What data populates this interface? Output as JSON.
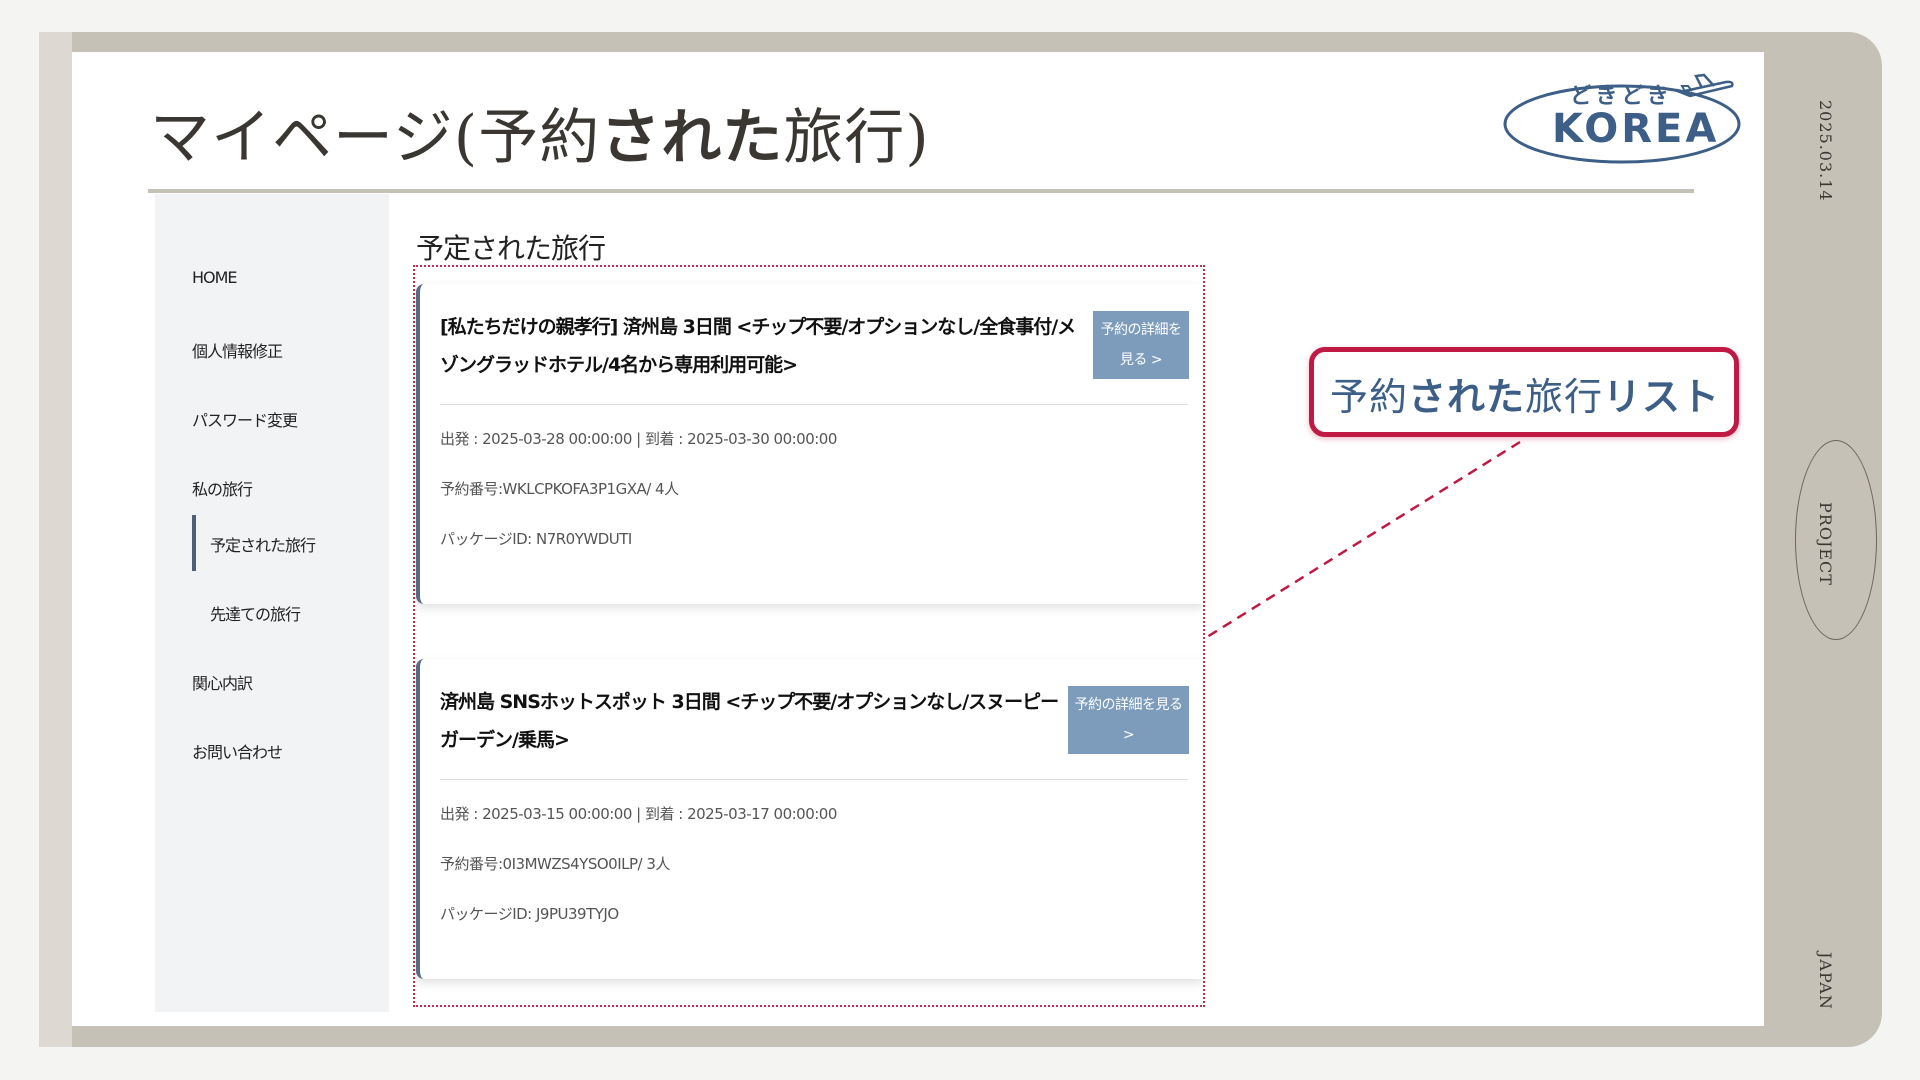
{
  "slide": {
    "title_part1": "マイページ(予約",
    "title_part2": "された",
    "title_part3": "旅行)",
    "date": "2025.03.14",
    "side_label_project": "PROJECT",
    "side_label_japan": "JAPAN"
  },
  "logo": {
    "top_text": "どきどき",
    "main_text": "KOREA",
    "icon": "airplane-icon"
  },
  "sidebar": {
    "items": [
      {
        "label": "HOME"
      },
      {
        "label": "個人情報修正"
      },
      {
        "label": "パスワード変更"
      },
      {
        "label": "私の旅行"
      },
      {
        "label": "予定された旅行"
      },
      {
        "label": "先達ての旅行"
      },
      {
        "label": "関心内訳"
      },
      {
        "label": "お問い合わせ"
      }
    ]
  },
  "main": {
    "section_title": "予定された旅行",
    "trips": [
      {
        "title": "[私たちだけの親孝行] 済州島 3日間 <チップ不要/オプションなし/全食事付/メゾングラッドホテル/4名から専用利用可能>",
        "detail_button": "予約の詳細を見る >",
        "dates": "出発 : 2025-03-28 00:00:00 | 到着 : 2025-03-30 00:00:00",
        "reservation": "予約番号:WKLCPKOFA3P1GXA/ 4人",
        "package": "パッケージID: N7R0YWDUTI"
      },
      {
        "title": "済州島 SNSホットスポット 3日間 <チップ不要/オプションなし/スヌーピーガーデン/乗馬>",
        "detail_button": "予約の詳細を見る >",
        "dates": "出発 : 2025-03-15 00:00:00 | 到着 : 2025-03-17 00:00:00",
        "reservation": "予約番号:0I3MWZS4YSO0ILP/ 3人",
        "package": "パッケージID: J9PU39TYJO"
      }
    ]
  },
  "callout": {
    "part1": "予約",
    "part2": "された",
    "part3": "旅行",
    "part4": "リスト"
  },
  "colors": {
    "frame": "#c6c1b7",
    "accent_blue": "#3d5f87",
    "button": "#7d9cbc",
    "callout_red": "#c01a44"
  }
}
